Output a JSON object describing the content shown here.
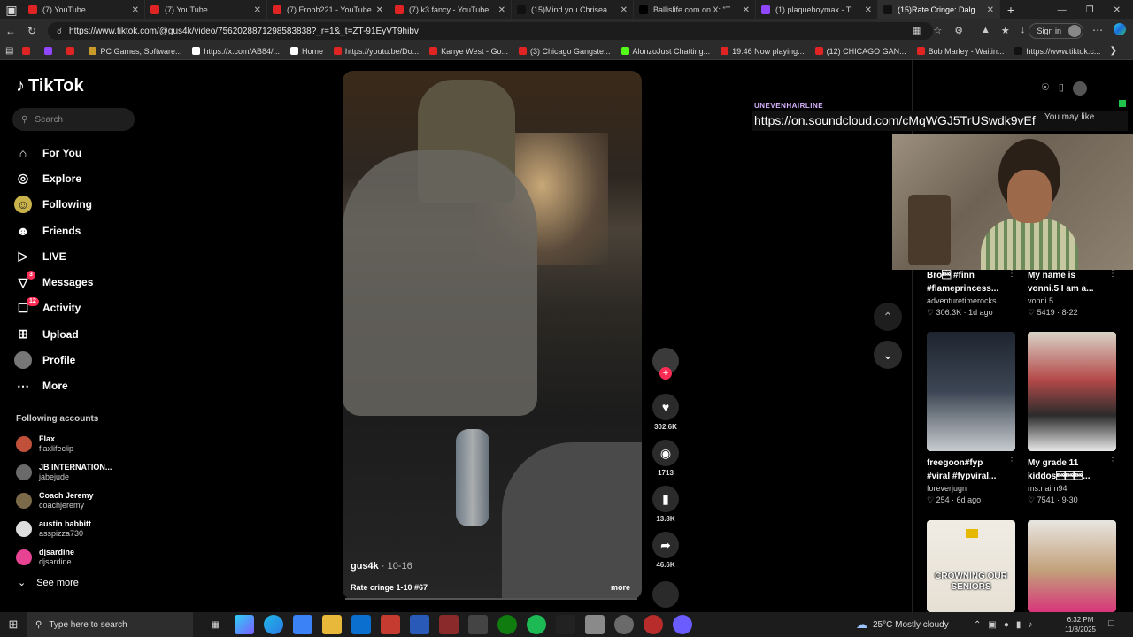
{
  "browser": {
    "tabs": [
      {
        "title": "(7) YouTube",
        "color": "#e02424"
      },
      {
        "title": "(7) YouTube",
        "color": "#e02424"
      },
      {
        "title": "(7) Erobb221 - YouTube",
        "color": "#e02424"
      },
      {
        "title": "(7) k3 fancy - YouTube",
        "color": "#e02424"
      },
      {
        "title": "(15)Mind you Chrisean jr is",
        "color": "#111111"
      },
      {
        "title": "Ballislife.com on X: \"TEAGUE",
        "color": "#000000"
      },
      {
        "title": "(1) plaqueboymax - Twitch",
        "color": "#9146ff"
      },
      {
        "title": "(15)Rate Cringe: Dalgona M",
        "color": "#111111"
      }
    ],
    "url": "https://www.tiktok.com/@gus4k/video/7562028871298583838?_r=1&_t=ZT-91EyVT9hibv",
    "sign_in": "Sign in",
    "bookmarks": [
      {
        "label": "",
        "color": "#e02424"
      },
      {
        "label": "",
        "color": "#9146ff"
      },
      {
        "label": "",
        "color": "#e02424"
      },
      {
        "label": "PC Games, Software...",
        "color": "#c89a2a"
      },
      {
        "label": "https://x.com/AB84/...",
        "color": "#ffffff"
      },
      {
        "label": "Home",
        "color": "#ffffff"
      },
      {
        "label": "https://youtu.be/Do...",
        "color": "#e02424"
      },
      {
        "label": "Kanye West - Go...",
        "color": "#e02424"
      },
      {
        "label": "(3) Chicago Gangste...",
        "color": "#e02424"
      },
      {
        "label": "AlonzoJust Chatting...",
        "color": "#53fc18"
      },
      {
        "label": "19:46 Now playing...",
        "color": "#e02424"
      },
      {
        "label": "(12) CHICAGO GAN...",
        "color": "#e02424"
      },
      {
        "label": "Bob Marley - Waitin...",
        "color": "#e02424"
      },
      {
        "label": "https://www.tiktok.c...",
        "color": "#111111"
      }
    ]
  },
  "tiktok": {
    "logo": "TikTok",
    "search_placeholder": "Search",
    "nav": [
      {
        "label": "For You",
        "icon": "home-icon",
        "badge": ""
      },
      {
        "label": "Explore",
        "icon": "compass-icon",
        "badge": ""
      },
      {
        "label": "Following",
        "icon": "following-icon",
        "badge": ""
      },
      {
        "label": "Friends",
        "icon": "friends-icon",
        "badge": ""
      },
      {
        "label": "LIVE",
        "icon": "live-icon",
        "badge": ""
      },
      {
        "label": "Messages",
        "icon": "messages-icon",
        "badge": "3"
      },
      {
        "label": "Activity",
        "icon": "activity-icon",
        "badge": "12"
      },
      {
        "label": "Upload",
        "icon": "upload-icon",
        "badge": ""
      },
      {
        "label": "Profile",
        "icon": "profile-icon",
        "badge": ""
      },
      {
        "label": "More",
        "icon": "more-icon",
        "badge": ""
      }
    ],
    "following_title": "Following accounts",
    "accounts": [
      {
        "name": "Flax",
        "handle": "flaxlifeclip",
        "color": "#c0503a"
      },
      {
        "name": "JB INTERNATION...",
        "handle": "jabejude",
        "color": "#6a6a6a"
      },
      {
        "name": "Coach Jeremy",
        "handle": "coachjeremy",
        "color": "#7a6a4a"
      },
      {
        "name": "austin babbitt",
        "handle": "asspizza730",
        "color": "#dddddd"
      },
      {
        "name": "djsardine",
        "handle": "djsardine",
        "color": "#e84393"
      }
    ],
    "see_more": "See more",
    "video": {
      "username": "gus4k",
      "date": " · 10-16",
      "caption": "Rate cringe 1-10 #67",
      "more": "more",
      "likes": "302.6K",
      "comments": "1713",
      "saves": "13.8K",
      "shares": "46.6K"
    },
    "overlay": {
      "tag": "UNEVENHAIRLINE",
      "url": "https://on.soundcloud.com/cMqWGJ5TrUSwdk9vEf",
      "may_like": "You may like"
    },
    "recommended": [
      {
        "title1": "Bro\u0005 #finn",
        "title2": "#flameprincess...",
        "user": "adventuretimerocks",
        "stats": "♡ 306.3K · 1d ago"
      },
      {
        "title1": "My name is",
        "title2": "vonni.5 I am a...",
        "user": "vonni.5",
        "stats": "♡ 5419 · 8-22"
      },
      {
        "title1": "freegoon#fyp",
        "title2": "#viral #fypviral...",
        "user": "foreverjugn",
        "stats": "♡ 254 · 6d ago"
      },
      {
        "title1": "My grade 11",
        "title2": "kiddos\u0005\u0005\u0005...",
        "user": "ms.nairn94",
        "stats": "♡ 7541 · 9-30"
      }
    ],
    "thumb_text": "CROWNING OUR SENIORS"
  },
  "taskbar": {
    "search": "Type here to search",
    "weather": "25°C  Mostly cloudy",
    "time": "6:32 PM",
    "date": "11/8/2025"
  }
}
